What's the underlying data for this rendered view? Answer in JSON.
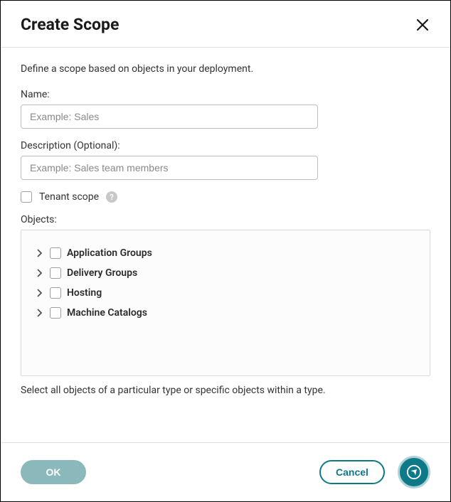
{
  "header": {
    "title": "Create Scope"
  },
  "intro": "Define a scope based on objects in your deployment.",
  "fields": {
    "name": {
      "label": "Name:",
      "placeholder": "Example: Sales",
      "value": ""
    },
    "description": {
      "label": "Description (Optional):",
      "placeholder": "Example: Sales team members",
      "value": ""
    }
  },
  "tenant_scope": {
    "label": "Tenant scope",
    "help": "?"
  },
  "objects": {
    "label": "Objects:",
    "items": [
      {
        "label": "Application Groups"
      },
      {
        "label": "Delivery Groups"
      },
      {
        "label": "Hosting"
      },
      {
        "label": "Machine Catalogs"
      }
    ]
  },
  "hint": "Select all objects of a particular type or specific objects within a type.",
  "footer": {
    "ok": "OK",
    "cancel": "Cancel"
  }
}
